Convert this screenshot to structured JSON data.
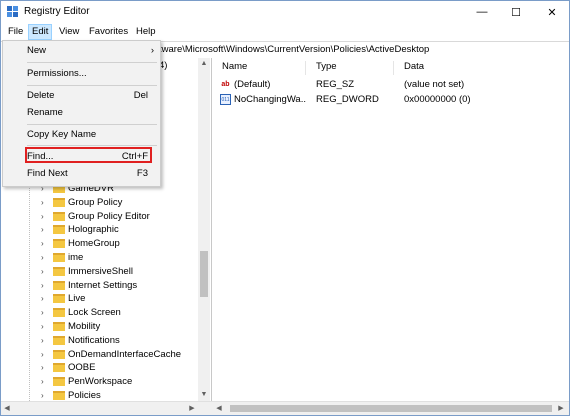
{
  "window": {
    "title": "Registry Editor",
    "minimize": "—",
    "maximize": "☐",
    "close": "✕"
  },
  "menubar": {
    "items": [
      "File",
      "Edit",
      "View",
      "Favorites",
      "Help"
    ]
  },
  "address": {
    "path": "tware\\Microsoft\\Windows\\CurrentVersion\\Policies\\ActiveDesktop"
  },
  "tree": {
    "partial_text": "4)",
    "items": [
      "GameDVR",
      "Group Policy",
      "Group Policy Editor",
      "Holographic",
      "HomeGroup",
      "ime",
      "ImmersiveShell",
      "Internet Settings",
      "Live",
      "Lock Screen",
      "Mobility",
      "Notifications",
      "OnDemandInterfaceCache",
      "OOBE",
      "PenWorkspace",
      "Policies"
    ]
  },
  "values_pane": {
    "columns": [
      "Name",
      "Type",
      "Data"
    ],
    "rows": [
      {
        "name": "(Default)",
        "type": "REG_SZ",
        "data": "(value not set)",
        "icon": "string-value-icon"
      },
      {
        "name": "NoChangingWa...",
        "type": "REG_DWORD",
        "data": "0x00000000 (0)",
        "icon": "dword-value-icon"
      }
    ]
  },
  "edit_menu": {
    "new": "New",
    "permissions": "Permissions...",
    "delete": "Delete",
    "delete_shortcut": "Del",
    "rename": "Rename",
    "copy_key_name": "Copy Key Name",
    "find": "Find...",
    "find_shortcut": "Ctrl+F",
    "find_next": "Find Next",
    "find_next_shortcut": "F3",
    "submenu_arrow": "›"
  },
  "colors": {
    "menu_active_bg": "#cce8ff",
    "highlight_border": "#e02020",
    "folder": "#f4c741"
  }
}
